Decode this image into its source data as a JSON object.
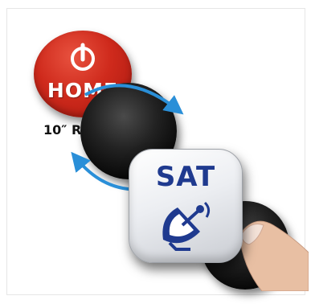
{
  "home_button": {
    "label": "HOME",
    "icon": "power-icon"
  },
  "caption": {
    "text": "10″ R"
  },
  "rotate": {
    "icon": "rotate-arrows-icon",
    "color": "#2a8fd8"
  },
  "sat_button": {
    "label": "SAT",
    "icon": "satellite-dish-icon",
    "color": "#1f3a8f"
  },
  "colors": {
    "home_red": "#cf2a1c",
    "knob_black": "#111111"
  }
}
